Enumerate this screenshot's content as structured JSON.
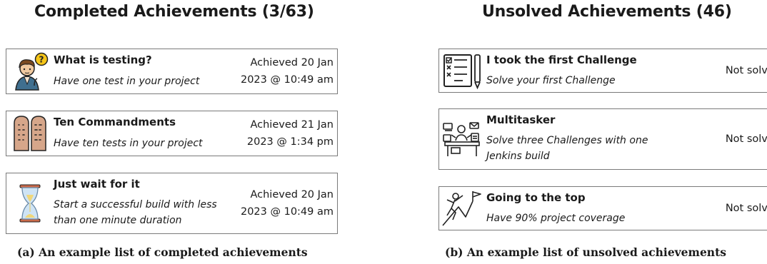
{
  "completed": {
    "title": "Completed Achievements (3/63)",
    "caption": "(a) An example list of completed achievements",
    "items": [
      {
        "name": "What is testing?",
        "description": "Have one test in your project",
        "status": "Achieved 20 Jan 2023 @ 10:49 am",
        "icon": "confused-person-icon"
      },
      {
        "name": "Ten Commandments",
        "description": "Have ten tests in your project",
        "status": "Achieved 21 Jan 2023 @ 1:34 pm",
        "icon": "stone-tablets-icon"
      },
      {
        "name": "Just wait for it",
        "description": "Start a successful build with less\nthan one minute duration",
        "status": "Achieved 20 Jan 2023 @ 10:49 am",
        "icon": "hourglass-icon"
      }
    ]
  },
  "unsolved": {
    "title": "Unsolved Achievements (46)",
    "caption": "(b) An example list of unsolved achievements",
    "items": [
      {
        "name": "I took the first Challenge",
        "description": "Solve your first Challenge",
        "status": "Not solved",
        "icon": "checklist-icon"
      },
      {
        "name": "Multitasker",
        "description": "Solve three Challenges with one\nJenkins build",
        "status": "Not solved",
        "icon": "multitasker-desk-icon"
      },
      {
        "name": "Going to the top",
        "description": "Have 90% project coverage",
        "status": "Not solved",
        "icon": "climber-flag-icon"
      }
    ]
  }
}
